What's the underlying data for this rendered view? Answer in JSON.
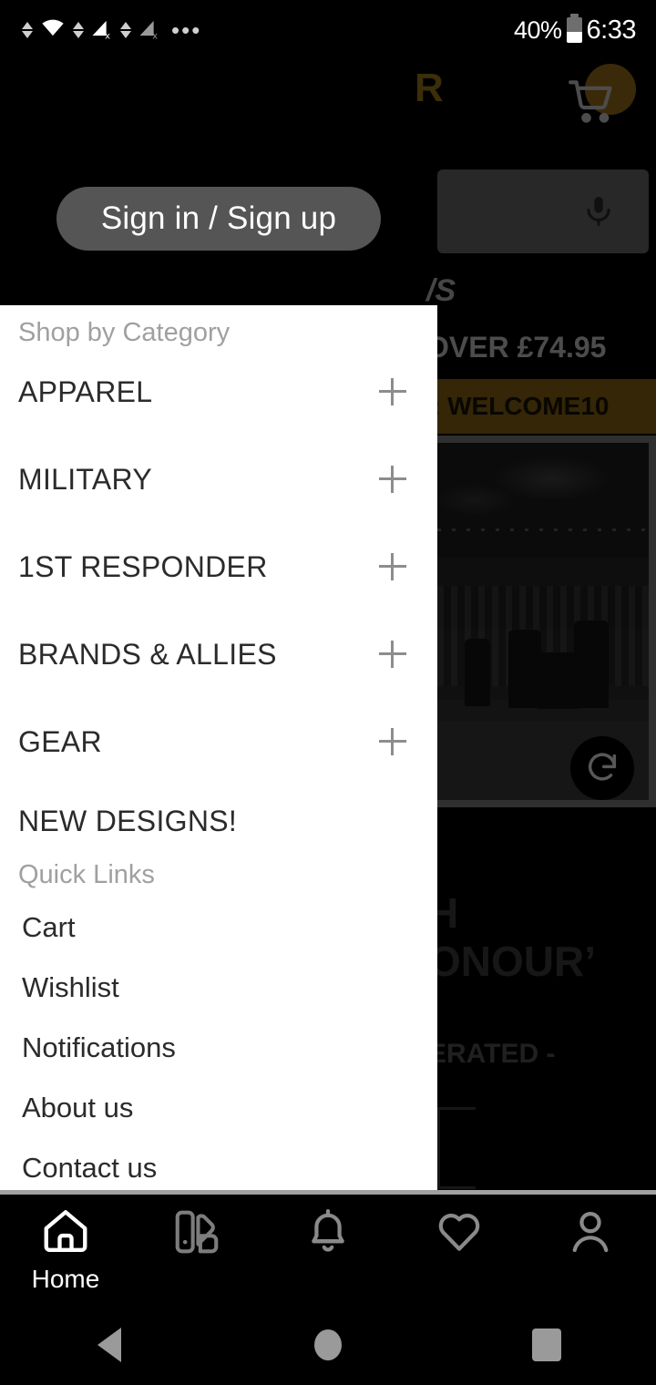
{
  "status_bar": {
    "battery_percent": "40%",
    "time": "6:33",
    "icons": [
      "wifi-icon",
      "signal-icon",
      "signal-icon",
      "more-dots-icon"
    ]
  },
  "background_page": {
    "logo_fragment": "R",
    "cart_icon": "shopping-cart-icon",
    "cart_badge_color": "#9a7018",
    "search_placeholder": "",
    "mic_icon": "microphone-icon",
    "headline_fragment": "/S",
    "shipping_text_fragment": "OVER £74.95",
    "promo_text_fragment": ": WELCOME10",
    "promo_bg_color": "#8a6511",
    "media_refresh_icon": "refresh-icon",
    "hero_line_1_fragment": "H",
    "hero_line_2_fragment": "ONOUR’",
    "hero_sub_fragment": "ERATED -"
  },
  "auth_button": {
    "label": "Sign in / Sign up"
  },
  "drawer": {
    "category_section_title": "Shop by Category",
    "categories": [
      {
        "label": "APPAREL",
        "expand_icon": "plus-icon",
        "expandable": true
      },
      {
        "label": "MILITARY",
        "expand_icon": "plus-icon",
        "expandable": true
      },
      {
        "label": "1ST RESPONDER",
        "expand_icon": "plus-icon",
        "expandable": true
      },
      {
        "label": "BRANDS & ALLIES",
        "expand_icon": "plus-icon",
        "expandable": true
      },
      {
        "label": "GEAR",
        "expand_icon": "plus-icon",
        "expandable": true
      },
      {
        "label": "NEW DESIGNS!",
        "expand_icon": "",
        "expandable": false
      }
    ],
    "quick_links_title": "Quick Links",
    "quick_links": [
      {
        "label": "Cart"
      },
      {
        "label": "Wishlist"
      },
      {
        "label": "Notifications"
      },
      {
        "label": "About us"
      },
      {
        "label": "Contact us"
      }
    ]
  },
  "bottom_nav": {
    "items": [
      {
        "label": "Home",
        "icon": "home-icon",
        "active": true
      },
      {
        "label": "",
        "icon": "collections-icon",
        "active": false
      },
      {
        "label": "",
        "icon": "bell-icon",
        "active": false
      },
      {
        "label": "",
        "icon": "heart-icon",
        "active": false
      },
      {
        "label": "",
        "icon": "person-icon",
        "active": false
      }
    ]
  },
  "android_nav": {
    "back": "back-triangle-icon",
    "home": "home-circle-icon",
    "recents": "recents-square-icon"
  }
}
